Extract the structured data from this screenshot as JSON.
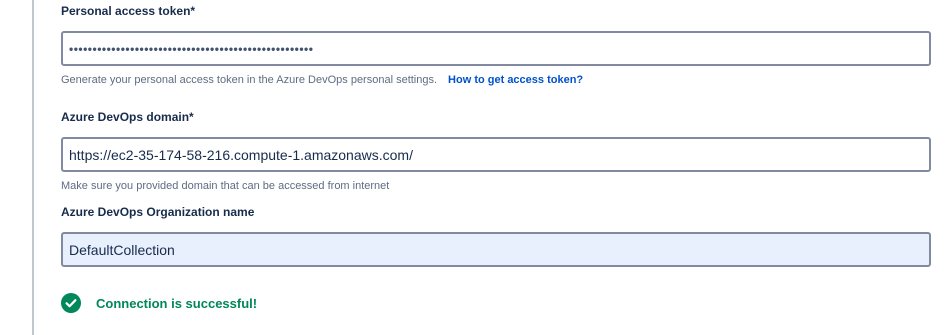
{
  "token": {
    "label": "Personal access token*",
    "value": "••••••••••••••••••••••••••••••••••••••••••••••••••••",
    "helper": "Generate your personal access token in the Azure DevOps personal settings.",
    "helper_link": "How to get access token?"
  },
  "domain": {
    "label": "Azure DevOps domain*",
    "value": "https://ec2-35-174-58-216.compute-1.amazonaws.com/",
    "helper": "Make sure you provided domain that can be accessed from internet"
  },
  "organization": {
    "label": "Azure DevOps Organization name",
    "value": "DefaultCollection"
  },
  "status": {
    "message": "Connection is successful!",
    "icon": "check-circle-icon",
    "color": "#00875a"
  },
  "colors": {
    "input_border": "#818aa0",
    "autofill_bg": "#e8f0fe",
    "link": "#0052cc"
  }
}
